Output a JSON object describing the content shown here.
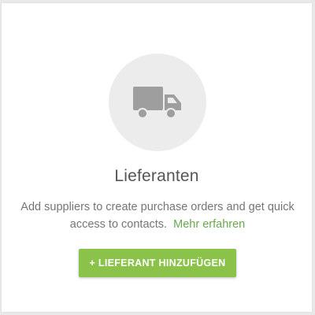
{
  "empty_state": {
    "icon": "truck-icon",
    "title": "Lieferanten",
    "description": "Add suppliers to create purchase orders and get quick access to contacts.",
    "learn_more_label": "Mehr erfahren",
    "add_button_label": "+ LIEFERANT HINZUFÜGEN"
  },
  "colors": {
    "accent": "#8bc34a",
    "link": "#6aa84f",
    "icon": "#9e9e9e",
    "icon_background": "#ececec"
  }
}
